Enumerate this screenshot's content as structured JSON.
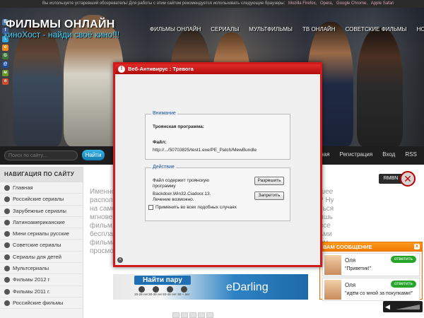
{
  "topbar": {
    "notice": "Вы используете устаревший обозреватель! Для работы с этим сайтом рекомендуется использовать следующие браузеры:",
    "browsers": [
      "Mozilla Firefox,",
      "Opera,",
      "Google Chrome,",
      "Apple Safari"
    ]
  },
  "header": {
    "title": "ФИЛЬМЫ ОНЛАЙН",
    "subtitle": "киноХост - найди своё кино!!!",
    "social": [
      "В",
      "f",
      "t",
      "o",
      "G",
      "@",
      "м",
      "я"
    ],
    "nav": [
      "ФИЛЬМЫ ОНЛАЙН",
      "СЕРИАЛЫ",
      "МУЛЬТФИЛЬМЫ",
      "ТВ ОНЛАЙН",
      "СОВЕТСКИЕ ФИЛЬМЫ",
      "НОВИНКИ"
    ]
  },
  "search": {
    "placeholder": "Поиск по сайту...",
    "button": "Найти"
  },
  "toplinks": [
    "вная",
    "Регистрация",
    "Вход",
    "RSS"
  ],
  "sidebar": {
    "heading": "НАВИГАЦИЯ ПО САЙТУ",
    "items": [
      "Главная",
      "Российские сериалы",
      "Зарубежные сериалы",
      "Латиноамериканские",
      "Мини сериалы русские",
      "Советские сериалы",
      "Сериалы для детей",
      "Мультсериалы",
      "Фильмы 2012 г",
      "Фильмы 2011 г.",
      "Российские фильмы"
    ]
  },
  "content": {
    "lines": [
      "Именно",
      "располо",
      "на само",
      "мгнове",
      "фильм,",
      "беспла",
      "фильма",
      "просмо"
    ],
    "right_lines": [
      "шее",
      "? Ну",
      "ться",
      "ишь",
      "все",
      "ьми",
      "ам",
      ""
    ]
  },
  "ad": {
    "title": "Найти пару",
    "ages": [
      "20-29 лет",
      "30-39 лет",
      "40-49 лет",
      "50 + лет"
    ],
    "brand": "eDarling"
  },
  "badge": "RMBN",
  "chat": {
    "header": "ВАМ СООБЩЕНИЕ",
    "messages": [
      {
        "name": "Оля",
        "reply": "ответить",
        "text": "\"Приветик!\""
      },
      {
        "name": "Оля",
        "reply": "ответить",
        "text": "\"идём со мной за покупками!\""
      }
    ]
  },
  "modal": {
    "title": "Веб-Антивирус : Тревога",
    "group1_label": "Внимание",
    "trojan": "Троянская программа:",
    "file_label": "Файл:",
    "file_path": "http://.../50703825/test1.exe/PE_Patch/MewBundle",
    "group2_label": "Действие",
    "desc1": "Файл содержит троянскую",
    "desc2": "программу",
    "malware": "Backdoor.Win32.Ciadoor.13.",
    "cure": "Лечение возможно.",
    "allow": "Разрешить",
    "deny": "Запретить",
    "apply_all": "Применить во всех подобных случаях"
  },
  "colors": {
    "modal_border": "#d11a1a",
    "accent_blue": "#1c58a8",
    "chat_orange": "#f07800",
    "search_btn": "#1a8fcc"
  }
}
